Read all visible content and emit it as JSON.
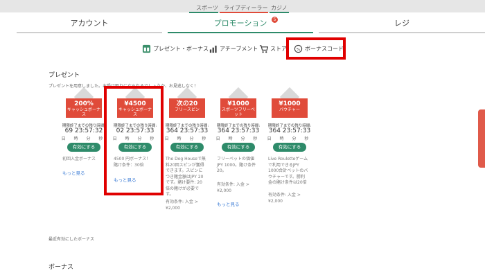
{
  "top_nav": {
    "sports": "スポーツ",
    "live_dealer": "ライブディーラー",
    "casino": "カジノ"
  },
  "tabs": {
    "account": "アカウント",
    "promotion": "プロモーション",
    "promotion_badge": "5",
    "register": "レジ"
  },
  "subnav": {
    "present_bonus": "プレゼント・ボーナス",
    "achievement": "アチーブメント",
    "store": "ストア",
    "bonus_code": "ボーナスコード"
  },
  "present": {
    "title": "プレゼント",
    "notice": "プレゼントを用意しました。お受け取りになられるでしょうか、お見逃しなく！"
  },
  "cards": [
    {
      "amount": "200%",
      "name": "キャッシュボーナス",
      "label": "期限終了までの残り時間:",
      "time": "69 23:57:32",
      "units": "日 時 分 秒",
      "button": "有効にする",
      "desc": "初回入金ボーナス",
      "more": "もっと見る",
      "cond": ""
    },
    {
      "amount": "¥4500",
      "name": "キャッシュボーナス",
      "label": "期限終了までの残り時間:",
      "time": "02 23:57:33",
      "units": "日 時 分 秒",
      "button": "有効にする",
      "desc": "4500 円ボーナス！賭け条件：30倍",
      "more": "もっと見る",
      "cond": ""
    },
    {
      "amount": "次の20",
      "name": "フリースピン",
      "label": "期限終了までの残り時間:",
      "time": "364 23:57:33",
      "units": "日 時 分 秒",
      "button": "有効にする",
      "desc": "The Dog Houseで無料20回スピンが獲得できます。スピンにつき賭金額はJPY 20です。賭け要件: 20倍の賭けが必要です。",
      "more": "",
      "cond": "有効条件: 入金 > ¥2,000"
    },
    {
      "amount": "¥1000",
      "name": "スポーツフリーベット",
      "label": "期限終了までの残り時間:",
      "time": "364 23:57:33",
      "units": "日 時 分 秒",
      "button": "有効にする",
      "desc": "フリーベットの価値JPY 1000。賭け条件20。",
      "more": "もっと見る",
      "cond": "有効条件: 入金 > ¥2,000"
    },
    {
      "amount": "¥1000",
      "name": "バウチャー",
      "label": "期限終了までの残り時間:",
      "time": "364 23:57:33",
      "units": "日 時 分 秒",
      "button": "有効にする",
      "desc": "Live Rouletteゲームで利用できるJPY 1000合計ベットのバウチャーです。勝利金の賭け条件は20倍",
      "more": "",
      "cond": "有効条件: 入金 > ¥2,000"
    }
  ],
  "recent": {
    "title": "最近有効にしたボーナス"
  },
  "bonus": {
    "title": "ボーナス"
  },
  "colors": {
    "accent": "#2e8b6a",
    "tag": "#e04b3a",
    "highlight": "#e00000"
  }
}
